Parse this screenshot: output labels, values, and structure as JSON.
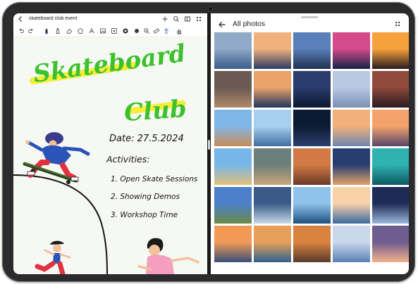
{
  "notes": {
    "title": "skateboard club event",
    "heading_line1": "Skateboard",
    "heading_line2": "Club",
    "date": "Date: 27.5.2024",
    "activities_label": "Activities:",
    "items": [
      "1. Open Skate Sessions",
      "2. Showing Demos",
      "3. Workshop Time"
    ]
  },
  "photos": {
    "title": "All photos",
    "tiles": [
      [
        "#8fa9c7",
        "#3a5c8a"
      ],
      [
        "#f0b27a",
        "#2b3a67"
      ],
      [
        "#5b7fb8",
        "#1f2f52"
      ],
      [
        "#d44a8a",
        "#142447"
      ],
      [
        "#f6a13b",
        "#2a1b1f"
      ],
      [
        "#6a5a52",
        "#b08a6a"
      ],
      [
        "#e9a36a",
        "#20345e"
      ],
      [
        "#2a3c6b",
        "#0e1730"
      ],
      [
        "#b9c8e3",
        "#7a8fb5"
      ],
      [
        "#8f4a3a",
        "#2a1a22"
      ],
      [
        "#7fb6e8",
        "#c98b55"
      ],
      [
        "#a7d0ef",
        "#3f6fa0"
      ],
      [
        "#0d1a33",
        "#2c3f6e"
      ],
      [
        "#f2b07a",
        "#6c86b0"
      ],
      [
        "#f3a36b",
        "#59456b"
      ],
      [
        "#77b6e6",
        "#e2c07a"
      ],
      [
        "#6d7f7a",
        "#c9a57a"
      ],
      [
        "#d27a45",
        "#6a3a2a"
      ],
      [
        "#283e72",
        "#e2a36a"
      ],
      [
        "#2fb2b0",
        "#0e5a60"
      ],
      [
        "#4b7fc9",
        "#6a8a4a"
      ],
      [
        "#3c5a88",
        "#c4d8e6"
      ],
      [
        "#8fc3ec",
        "#1d4f7e"
      ],
      [
        "#f7d1a8",
        "#3a6aa0"
      ],
      [
        "#1f2b57",
        "#9ab6d8"
      ],
      [
        "#f29a55",
        "#3a4f7a"
      ],
      [
        "#e6a05a",
        "#2f5f8f"
      ],
      [
        "#d8833f",
        "#5a3a2a"
      ],
      [
        "#c9d8ea",
        "#5a7fb5"
      ],
      [
        "#6f5d8f",
        "#f3b08a"
      ]
    ]
  },
  "colors": {
    "highlight_yellow": "#f4ee3a",
    "heading_green": "#3cc12c",
    "ink": "#141414",
    "accent_blue": "#3f6fd8"
  },
  "icons": [
    "back-icon",
    "undo-icon",
    "redo-icon",
    "pen-icon",
    "marker-icon",
    "eraser-icon",
    "lasso-icon",
    "shape-icon",
    "image-icon",
    "sticker-icon",
    "color-icon",
    "stroke-icon",
    "zoom-icon",
    "ruler-icon",
    "accessibility-icon",
    "palm-icon",
    "add-icon",
    "search-icon",
    "layout-icon",
    "more-icon"
  ]
}
